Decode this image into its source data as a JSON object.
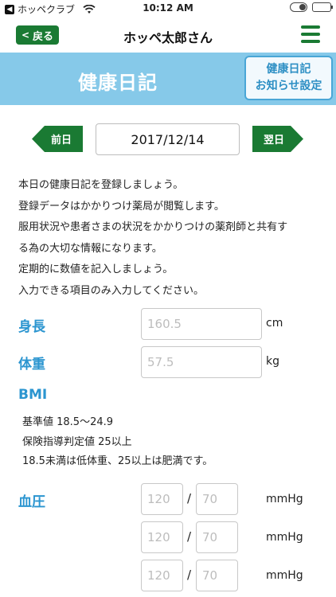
{
  "status_bar": {
    "back_app_label": "ホッペクラブ",
    "time": "10:12 AM"
  },
  "nav": {
    "back_label": "戻る",
    "title": "ホッペ太郎さん"
  },
  "banner": {
    "title": "健康日記",
    "settings_line1": "健康日記",
    "settings_line2": "お知らせ設定"
  },
  "date_nav": {
    "prev_label": "前日",
    "date": "2017/12/14",
    "next_label": "翌日"
  },
  "description": [
    "本日の健康日記を登録しましょう。",
    "登録データはかかりつけ薬局が閲覧します。",
    "服用状況や患者さまの状況をかかりつけの薬剤師と共有す",
    "る為の大切な情報になります。",
    "定期的に数値を記入しましょう。",
    "入力できる項目のみ入力してください。"
  ],
  "height": {
    "label": "身長",
    "placeholder": "160.5",
    "unit": "cm"
  },
  "weight": {
    "label": "体重",
    "placeholder": "57.5",
    "unit": "kg"
  },
  "bmi": {
    "label": "BMI",
    "notes": [
      "基準値 18.5〜24.9",
      "保険指導判定値 25以上",
      "18.5未満は低体重、25以上は肥満です。"
    ]
  },
  "blood_pressure": {
    "label": "血圧",
    "slash": "/",
    "unit": "mmHg",
    "rows": [
      {
        "systolic_placeholder": "120",
        "diastolic_placeholder": "70"
      },
      {
        "systolic_placeholder": "120",
        "diastolic_placeholder": "70"
      },
      {
        "systolic_placeholder": "120",
        "diastolic_placeholder": "70"
      }
    ]
  },
  "colors": {
    "primary_green": "#1a7a33",
    "banner_blue": "#86c9e9",
    "label_blue": "#2b95d0"
  }
}
